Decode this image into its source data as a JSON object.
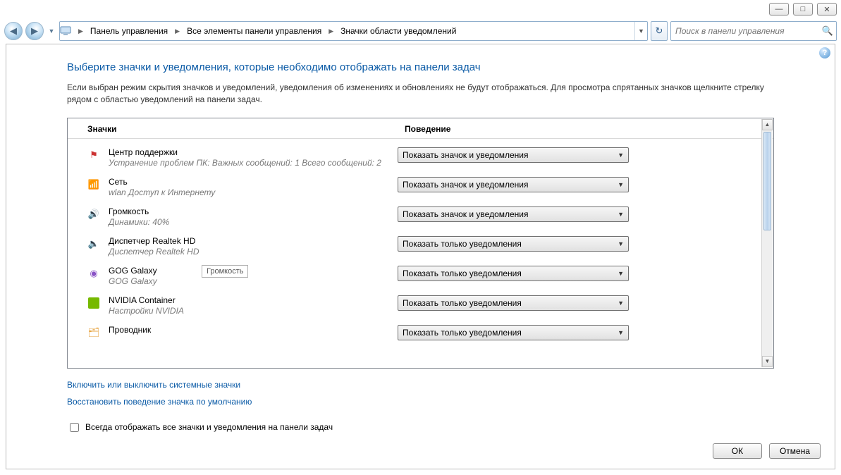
{
  "window_controls": {
    "min": "—",
    "max": "□",
    "close": "✕"
  },
  "breadcrumb": {
    "seg1": "Панель управления",
    "seg2": "Все элементы панели управления",
    "seg3": "Значки области уведомлений"
  },
  "search": {
    "placeholder": "Поиск в панели управления"
  },
  "page": {
    "title": "Выберите значки и уведомления, которые необходимо отображать на панели задач",
    "description": "Если выбран режим скрытия значков и уведомлений, уведомления об изменениях и обновлениях не будут отображаться. Для просмотра спрятанных значков щелкните стрелку рядом с областью уведомлений на панели задач."
  },
  "columns": {
    "icons": "Значки",
    "behavior": "Поведение"
  },
  "behaviors": {
    "show_all": "Показать значок и уведомления",
    "notif_only": "Показать только уведомления"
  },
  "tooltip": "Громкость",
  "rows": [
    {
      "icon": "flag",
      "title": "Центр поддержки",
      "sub": "Устранение проблем ПК: Важных сообщений: 1  Всего сообщений: 2",
      "sel": "show_all"
    },
    {
      "icon": "net",
      "title": "Сеть",
      "sub": "wlan Доступ к Интернету",
      "sel": "show_all"
    },
    {
      "icon": "vol",
      "title": "Громкость",
      "sub": "Динамики: 40%",
      "sel": "show_all"
    },
    {
      "icon": "rt",
      "title": "Диспетчер Realtek HD",
      "sub": "Диспетчер Realtek HD",
      "sel": "notif_only"
    },
    {
      "icon": "gog",
      "title": "GOG Galaxy",
      "sub": "GOG Galaxy",
      "sel": "notif_only"
    },
    {
      "icon": "nv",
      "title": "NVIDIA Container",
      "sub": "Настройки NVIDIA",
      "sel": "notif_only"
    },
    {
      "icon": "exp",
      "title": "Проводник",
      "sub": "",
      "sel": "notif_only"
    }
  ],
  "links": {
    "toggle_system": "Включить или выключить системные значки",
    "restore_default": "Восстановить поведение значка по умолчанию"
  },
  "checkbox_label": "Всегда отображать все значки и уведомления на панели задач",
  "buttons": {
    "ok": "ОК",
    "cancel": "Отмена"
  }
}
